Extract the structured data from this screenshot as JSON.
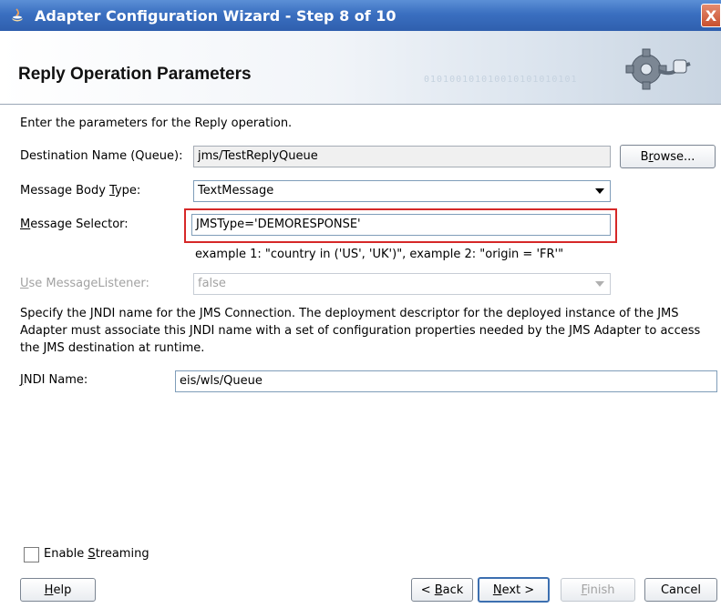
{
  "window": {
    "title": "Adapter Configuration Wizard - Step 8 of 10",
    "close_glyph": "X"
  },
  "header": {
    "title": "Reply Operation Parameters",
    "binary_text": "010100101010010101010101"
  },
  "intro": "Enter the parameters for the Reply operation.",
  "destination": {
    "label": "Destination Name (Queue):",
    "value": "jms/TestReplyQueue",
    "browse_label": "Browse..."
  },
  "body_type": {
    "label": "Message Body Type:",
    "value": "TextMessage"
  },
  "selector": {
    "label": "Message Selector:",
    "value": "JMSType='DEMORESPONSE'",
    "example": "example 1: \"country in ('US', 'UK')\", example 2: \"origin = 'FR'\""
  },
  "listener": {
    "label": "Use MessageListener:",
    "value": "false"
  },
  "jndi_description": [
    "Specify the JNDI name for the JMS Connection.  The deployment descriptor for the deployed instance of the JMS",
    "Adapter must associate this JNDI name with a set of configuration properties needed by the JMS Adapter to access",
    "the JMS destination at runtime."
  ],
  "jndi": {
    "label": "JNDI Name:",
    "value": "eis/wls/Queue"
  },
  "streaming": {
    "label": "Enable Streaming",
    "checked": false
  },
  "buttons": {
    "help": "Help",
    "back": "< Back",
    "next": "Next >",
    "finish": "Finish",
    "cancel": "Cancel"
  }
}
